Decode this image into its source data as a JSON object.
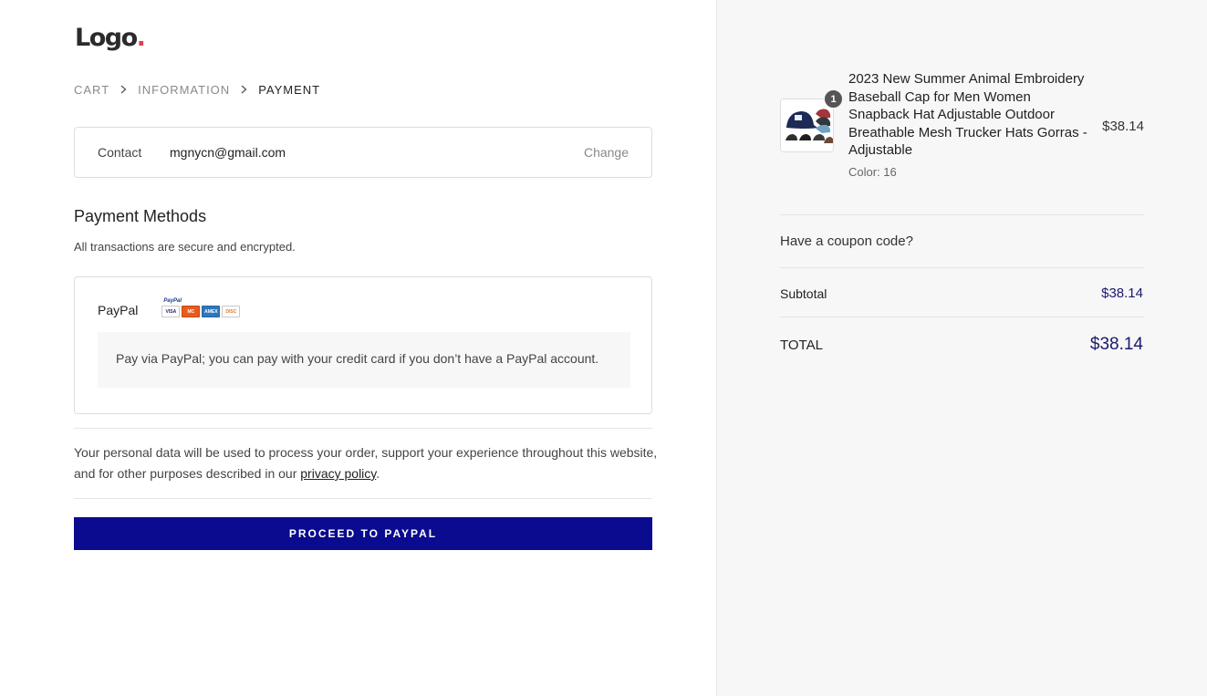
{
  "logo": {
    "text": "Logo",
    "dot": "."
  },
  "breadcrumb": {
    "items": [
      {
        "label": "CART",
        "active": false
      },
      {
        "label": "INFORMATION",
        "active": false
      },
      {
        "label": "PAYMENT",
        "active": true
      }
    ],
    "separator": "chevron-right-icon"
  },
  "contact": {
    "label": "Contact",
    "value": "mgnycn@gmail.com",
    "change_label": "Change"
  },
  "payment": {
    "title": "Payment Methods",
    "subtitle": "All transactions are secure and encrypted.",
    "method_label": "PayPal",
    "logo_text": "PayPal",
    "cards": [
      "VISA",
      "MC",
      "AMEX",
      "DISC"
    ],
    "description": "Pay via PayPal; you can pay with your credit card if you don’t have a PayPal account."
  },
  "privacy": {
    "text_before": "Your personal data will be used to process your order, support your experience throughout this website, and for other purposes described in our ",
    "link_text": "privacy policy",
    "text_after": "."
  },
  "proceed_button": {
    "label": "PROCEED TO PAYPAL"
  },
  "summary": {
    "product": {
      "name": "2023 New Summer Animal Embroidery Baseball Cap for Men Women Snapback Hat Adjustable Outdoor Breathable Mesh Trucker Hats Gorras - Adjustable",
      "quantity": "1",
      "variant": "Color: 16",
      "price": "$38.14"
    },
    "coupon_text": "Have a coupon code?",
    "subtotal_label": "Subtotal",
    "subtotal_value": "$38.14",
    "total_label": "TOTAL",
    "total_value": "$38.14"
  },
  "colors": {
    "accent": "#0a0b8f",
    "price_text": "#1a1a6e",
    "logo_dot": "#e0404a",
    "sidebar_bg": "#f7f7f7"
  }
}
